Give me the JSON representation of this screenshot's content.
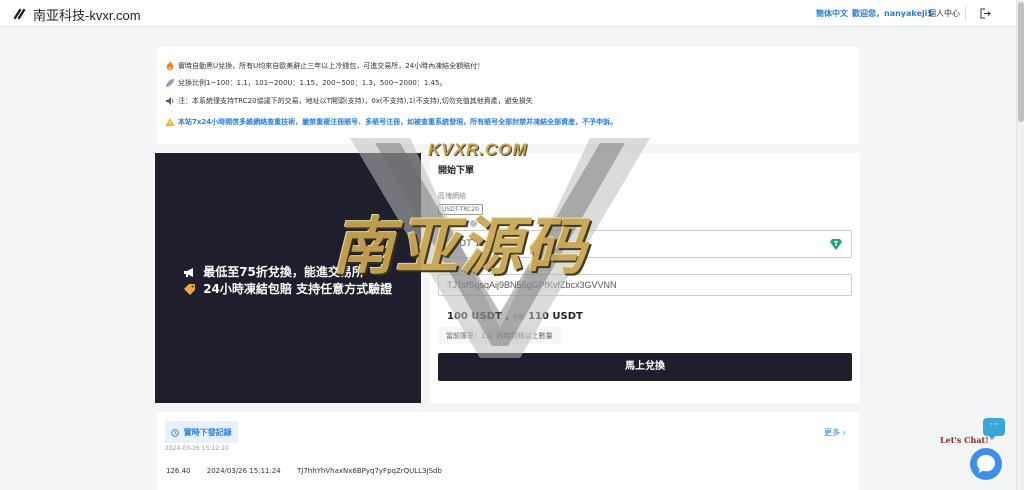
{
  "header": {
    "site_title": "南亚科技-kvxr.com",
    "lang": "簡体中文",
    "welcome": "歡迎您，nanyakeji1",
    "personal_center": "個人中心"
  },
  "notice": {
    "line1": "實時自動黑U兌換，所有U均來自歐美辭止三年以上冷錢包，可進交易所，24小時內凍結全額賠付！",
    "line2": "兌換比例1~100：1.1，101~200U：1.15，200~500：1.3，500~2000：1.45。",
    "line3": "注：本系統僅支持TRC20協議下的交易，地址以T開頭(支持)，0x(不支持),1(不支持),切勿充值其他資產，避免損失",
    "warning": "本站7x24小時開啓多維網絡查重技術，嚴禁重複注冊賬号、多賬号注冊，如被查重系統發現，所有賬号全部封禁并凍結全部資産，不予申訴。"
  },
  "promo": {
    "line1": "最低至75折兌換，能進交易所",
    "line2": "24小時凍結包賠 支持任意方式驗證"
  },
  "order": {
    "title": "開始下單",
    "network_label": "區塊網絡",
    "network_value": "USDT-TRC20",
    "amount_label": "兌換金額",
    "amount_value": "USDT 100",
    "address_label": "收款地址",
    "address_value": "TJTsfSqsqAij9BN56gGPfKvfZbcx3GVVNN",
    "calc_from": "100 USDT ,",
    "calc_mid": "到賬",
    "calc_to": "110 USDT",
    "rate_label": "當前匯率：",
    "rate_value": "1.1",
    "rate_note": "同時到賬以上數量",
    "submit": "馬上兌換"
  },
  "records": {
    "tab": "實時下發記錄",
    "more": "更多",
    "time": "2024-03-26 15:12:10",
    "rows": [
      {
        "amount": "126.40",
        "datetime": "2024/03/26 15:11:24",
        "address": "TJ7hhYhVhaxNx6BPyq7yFpqZrQULL3JSdb"
      }
    ]
  },
  "chat": {
    "label": "Let's Chat!",
    "bubble": "···"
  },
  "watermark": {
    "top": "KVXR.COM",
    "main": "南亚源码"
  },
  "colors": {
    "accent": "#2a7ee0",
    "dark_panel": "#1e1e2d",
    "gold": "#c8a653"
  }
}
